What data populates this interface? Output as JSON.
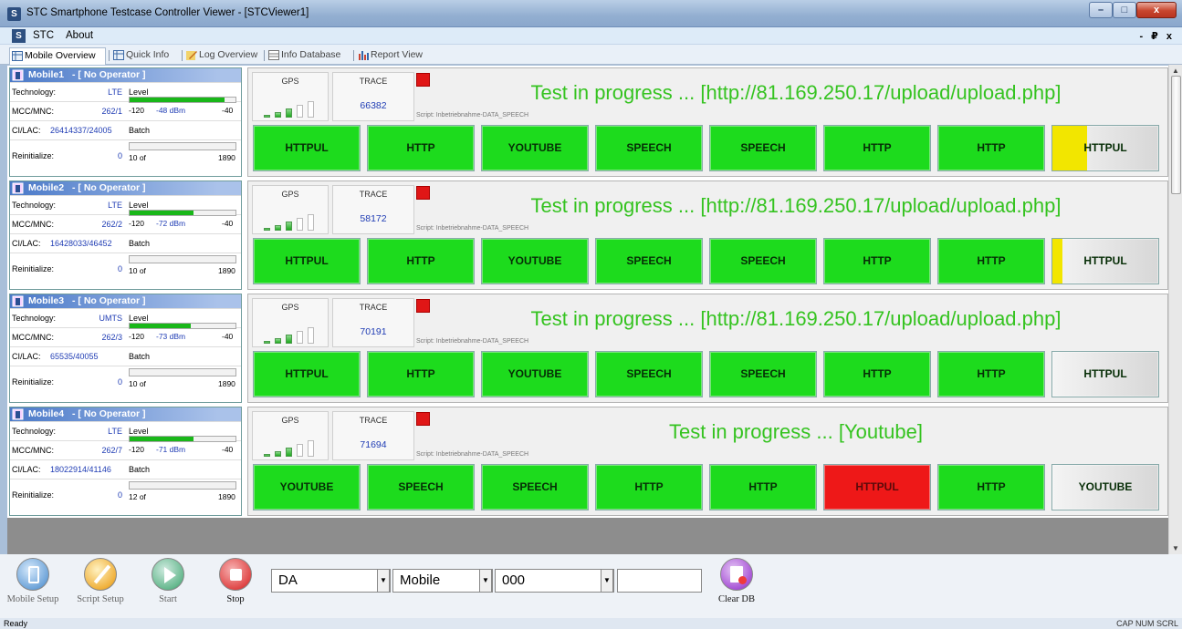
{
  "window": {
    "title": "STC Smartphone Testcase Controller Viewer - [STCViewer1]",
    "app_icon_letter": "S",
    "minimize": "–",
    "maximize": "□",
    "close": "x"
  },
  "menu": {
    "icon_letter": "S",
    "items": [
      "STC",
      "About"
    ],
    "mdi_controls": "- ₽ x"
  },
  "tabs": [
    {
      "label": "Mobile Overview",
      "active": true,
      "icon": "grid-icon"
    },
    {
      "label": "Quick Info",
      "active": false,
      "icon": "grid-icon"
    },
    {
      "label": "Log Overview",
      "active": false,
      "icon": "pencil-icon"
    },
    {
      "label": "Info Database",
      "active": false,
      "icon": "database-icon"
    },
    {
      "label": "Report View",
      "active": false,
      "icon": "barchart-icon"
    }
  ],
  "labels": {
    "technology": "Technology:",
    "mcc": "MCC/MNC:",
    "cilac": "CI/LAC:",
    "reinit": "Reinitialize:",
    "level": "Level",
    "batch": "Batch",
    "gps": "GPS",
    "trace": "TRACE",
    "scale_min": "-120",
    "scale_max": "-40",
    "batch_max": "1890"
  },
  "mobiles": [
    {
      "name": "Mobile1",
      "operator": "- [ No Operator ]",
      "technology": "LTE",
      "mcc_mnc": "262/1",
      "ci_lac": "26414337/24005",
      "reinit": "0",
      "level_dbm": "-48 dBm",
      "level_fraction": 0.9,
      "batch_text": "10 of",
      "batch_fraction": 0.0,
      "gps_bars": 2,
      "trace": "66382",
      "script": "Script: Inbetriebnahme-DATA_SPEECH",
      "status": "Test in progress ... [http://81.169.250.17/upload/upload.php]",
      "buttons": [
        {
          "label": "HTTPUL",
          "state": "green"
        },
        {
          "label": "HTTP",
          "state": "green"
        },
        {
          "label": "YOUTUBE",
          "state": "green"
        },
        {
          "label": "SPEECH",
          "state": "green"
        },
        {
          "label": "SPEECH",
          "state": "green"
        },
        {
          "label": "HTTP",
          "state": "green"
        },
        {
          "label": "HTTP",
          "state": "green"
        },
        {
          "label": "HTTPUL",
          "state": "progress"
        }
      ]
    },
    {
      "name": "Mobile2",
      "operator": "- [ No Operator ]",
      "technology": "LTE",
      "mcc_mnc": "262/2",
      "ci_lac": "16428033/46452",
      "reinit": "0",
      "level_dbm": "-72 dBm",
      "level_fraction": 0.6,
      "batch_text": "10 of",
      "batch_fraction": 0.0,
      "gps_bars": 2,
      "trace": "58172",
      "script": "Script: Inbetriebnahme-DATA_SPEECH",
      "status": "Test in progress ... [http://81.169.250.17/upload/upload.php]",
      "buttons": [
        {
          "label": "HTTPUL",
          "state": "green"
        },
        {
          "label": "HTTP",
          "state": "green"
        },
        {
          "label": "YOUTUBE",
          "state": "green"
        },
        {
          "label": "SPEECH",
          "state": "green"
        },
        {
          "label": "SPEECH",
          "state": "green"
        },
        {
          "label": "HTTP",
          "state": "green"
        },
        {
          "label": "HTTP",
          "state": "green"
        },
        {
          "label": "HTTPUL",
          "state": "started"
        }
      ]
    },
    {
      "name": "Mobile3",
      "operator": "- [ No Operator ]",
      "technology": "UMTS",
      "mcc_mnc": "262/3",
      "ci_lac": "65535/40055",
      "reinit": "0",
      "level_dbm": "-73 dBm",
      "level_fraction": 0.58,
      "batch_text": "10 of",
      "batch_fraction": 0.0,
      "gps_bars": 2,
      "trace": "70191",
      "script": "Script: Inbetriebnahme-DATA_SPEECH",
      "status": "Test in progress ... [http://81.169.250.17/upload/upload.php]",
      "buttons": [
        {
          "label": "HTTPUL",
          "state": "green"
        },
        {
          "label": "HTTP",
          "state": "green"
        },
        {
          "label": "YOUTUBE",
          "state": "green"
        },
        {
          "label": "SPEECH",
          "state": "green"
        },
        {
          "label": "SPEECH",
          "state": "green"
        },
        {
          "label": "HTTP",
          "state": "green"
        },
        {
          "label": "HTTP",
          "state": "green"
        },
        {
          "label": "HTTPUL",
          "state": "gray"
        }
      ]
    },
    {
      "name": "Mobile4",
      "operator": "- [ No Operator ]",
      "technology": "LTE",
      "mcc_mnc": "262/7",
      "ci_lac": "18022914/41146",
      "reinit": "0",
      "level_dbm": "-71 dBm",
      "level_fraction": 0.6,
      "batch_text": "12 of",
      "batch_fraction": 0.0,
      "gps_bars": 2,
      "trace": "71694",
      "script": "Script: Inbetriebnahme-DATA_SPEECH",
      "status": "Test in progress ... [Youtube]",
      "buttons": [
        {
          "label": "YOUTUBE",
          "state": "green"
        },
        {
          "label": "SPEECH",
          "state": "green"
        },
        {
          "label": "SPEECH",
          "state": "green"
        },
        {
          "label": "HTTP",
          "state": "green"
        },
        {
          "label": "HTTP",
          "state": "green"
        },
        {
          "label": "HTTPUL",
          "state": "red"
        },
        {
          "label": "HTTP",
          "state": "green"
        },
        {
          "label": "YOUTUBE",
          "state": "gray"
        }
      ]
    }
  ],
  "toolbar": {
    "mobile_setup": "Mobile Setup",
    "script_setup": "Script Setup",
    "start": "Start",
    "stop": "Stop",
    "combo1": "DA",
    "combo2": "Mobile",
    "combo3": "000",
    "combo4": "",
    "clear_db": "Clear DB"
  },
  "statusbar": {
    "text": "Ready",
    "indicators": "CAP  NUM  SCRL"
  },
  "colors": {
    "ok_green": "#1ddb1d",
    "fail_red": "#ee1818",
    "progress_yellow": "#f2e600",
    "status_text_green": "#35c320"
  }
}
